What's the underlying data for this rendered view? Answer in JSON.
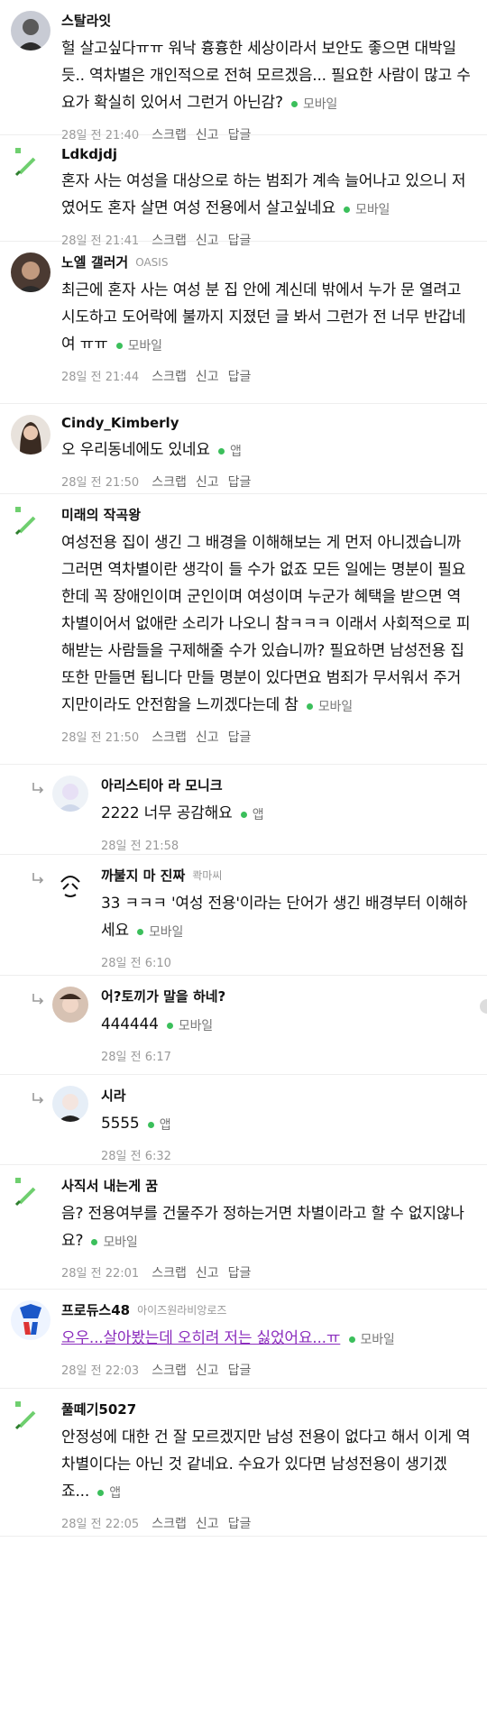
{
  "comments": [
    {
      "name": "스탈라잇",
      "text": "헐 살고싶다ㅠㅠ 워낙 흉흉한 세상이라서 보안도 좋으면 대박일 듯.. 역차별은 개인적으로 전혀 모르겠음... 필요한 사람이 많고 수요가 확실히 있어서 그런거 아닌감?",
      "source": "모바일",
      "time": "28일 전 21:40",
      "scrap": "스크랩",
      "report": "신고",
      "reply": "답글"
    },
    {
      "name": "Ldkdjdj",
      "text": "혼자 사는 여성을 대상으로 하는 범죄가 계속 늘어나고 있으니 저였어도 혼자 살면 여성 전용에서 살고싶네요",
      "source": "모바일",
      "time": "28일 전 21:41",
      "scrap": "스크랩",
      "report": "신고",
      "reply": "답글"
    },
    {
      "name": "노엘 갤러거",
      "tag": "OASIS",
      "text": "최근에 혼자 사는 여성 분 집 안에 계신데 밖에서 누가 문 열려고 시도하고 도어락에 불까지 지졌던 글 봐서 그런가 전 너무 반갑네여 ㅠㅠ",
      "source": "모바일",
      "time": "28일 전 21:44",
      "scrap": "스크랩",
      "report": "신고",
      "reply": "답글"
    },
    {
      "name": "Cindy_Kimberly",
      "text": "오 우리동네에도 있네요",
      "source": "앱",
      "time": "28일 전 21:50",
      "scrap": "스크랩",
      "report": "신고",
      "reply": "답글"
    },
    {
      "name": "미래의 작곡왕",
      "text": "여성전용 집이 생긴 그 배경을 이해해보는 게 먼저 아니겠습니까 그러면 역차별이란 생각이 들 수가 없죠 모든 일에는 명분이 필요한데 꼭 장애인이며 군인이며 여성이며 누군가 혜택을 받으면 역차별이어서 없애란 소리가 나오니 참ㅋㅋㅋ 이래서 사회적으로 피해받는 사람들을 구제해줄 수가 있습니까? 필요하면 남성전용 집 또한 만들면 됩니다 만들 명분이 있다면요 범죄가 무서워서 주거지만이라도 안전함을 느끼겠다는데 참",
      "source": "모바일",
      "time": "28일 전 21:50",
      "scrap": "스크랩",
      "report": "신고",
      "reply": "답글"
    }
  ],
  "replies": [
    {
      "name": "아리스티아 라 모니크",
      "text": "2222 너무 공감해요",
      "source": "앱",
      "time": "28일 전 21:58"
    },
    {
      "name": "까불지 마 진짜",
      "tag": "콱마씨",
      "text": "33 ㅋㅋㅋ '여성 전용'이라는 단어가 생긴 배경부터 이해하세요",
      "source": "모바일",
      "time": "28일 전 6:10"
    },
    {
      "name": "어?토끼가 말을 하네?",
      "text": "444444",
      "source": "모바일",
      "time": "28일 전 6:17"
    },
    {
      "name": "시라",
      "text": "5555",
      "source": "앱",
      "time": "28일 전 6:32"
    }
  ],
  "comments2": [
    {
      "name": "사직서 내는게 꿈",
      "text": "음? 전용여부를 건물주가 정하는거면 차별이라고 할 수 없지않나요?",
      "source": "모바일",
      "time": "28일 전 22:01",
      "scrap": "스크랩",
      "report": "신고",
      "reply": "답글"
    },
    {
      "name": "프로듀스48",
      "tag": "아이즈원라비앙로즈",
      "text": "오우...살아봤는데 오히려 저는 싫었어요...ㅠ",
      "source": "모바일",
      "time": "28일 전 22:03",
      "scrap": "스크랩",
      "report": "신고",
      "reply": "답글"
    },
    {
      "name": "풀떼기5027",
      "text": "안정성에 대한 건 잘 모르겠지만 남성 전용이 없다고 해서 이게 역차별이다는 아닌 것 같네요. 수요가 있다면 남성전용이 생기겠죠...",
      "source": "앱",
      "time": "28일 전 22:05",
      "scrap": "스크랩",
      "report": "신고",
      "reply": "답글"
    }
  ],
  "colors": {
    "accent_green": "#3bbf5b",
    "link_purple": "#8b2dbd",
    "muted": "#9a9a9a"
  }
}
